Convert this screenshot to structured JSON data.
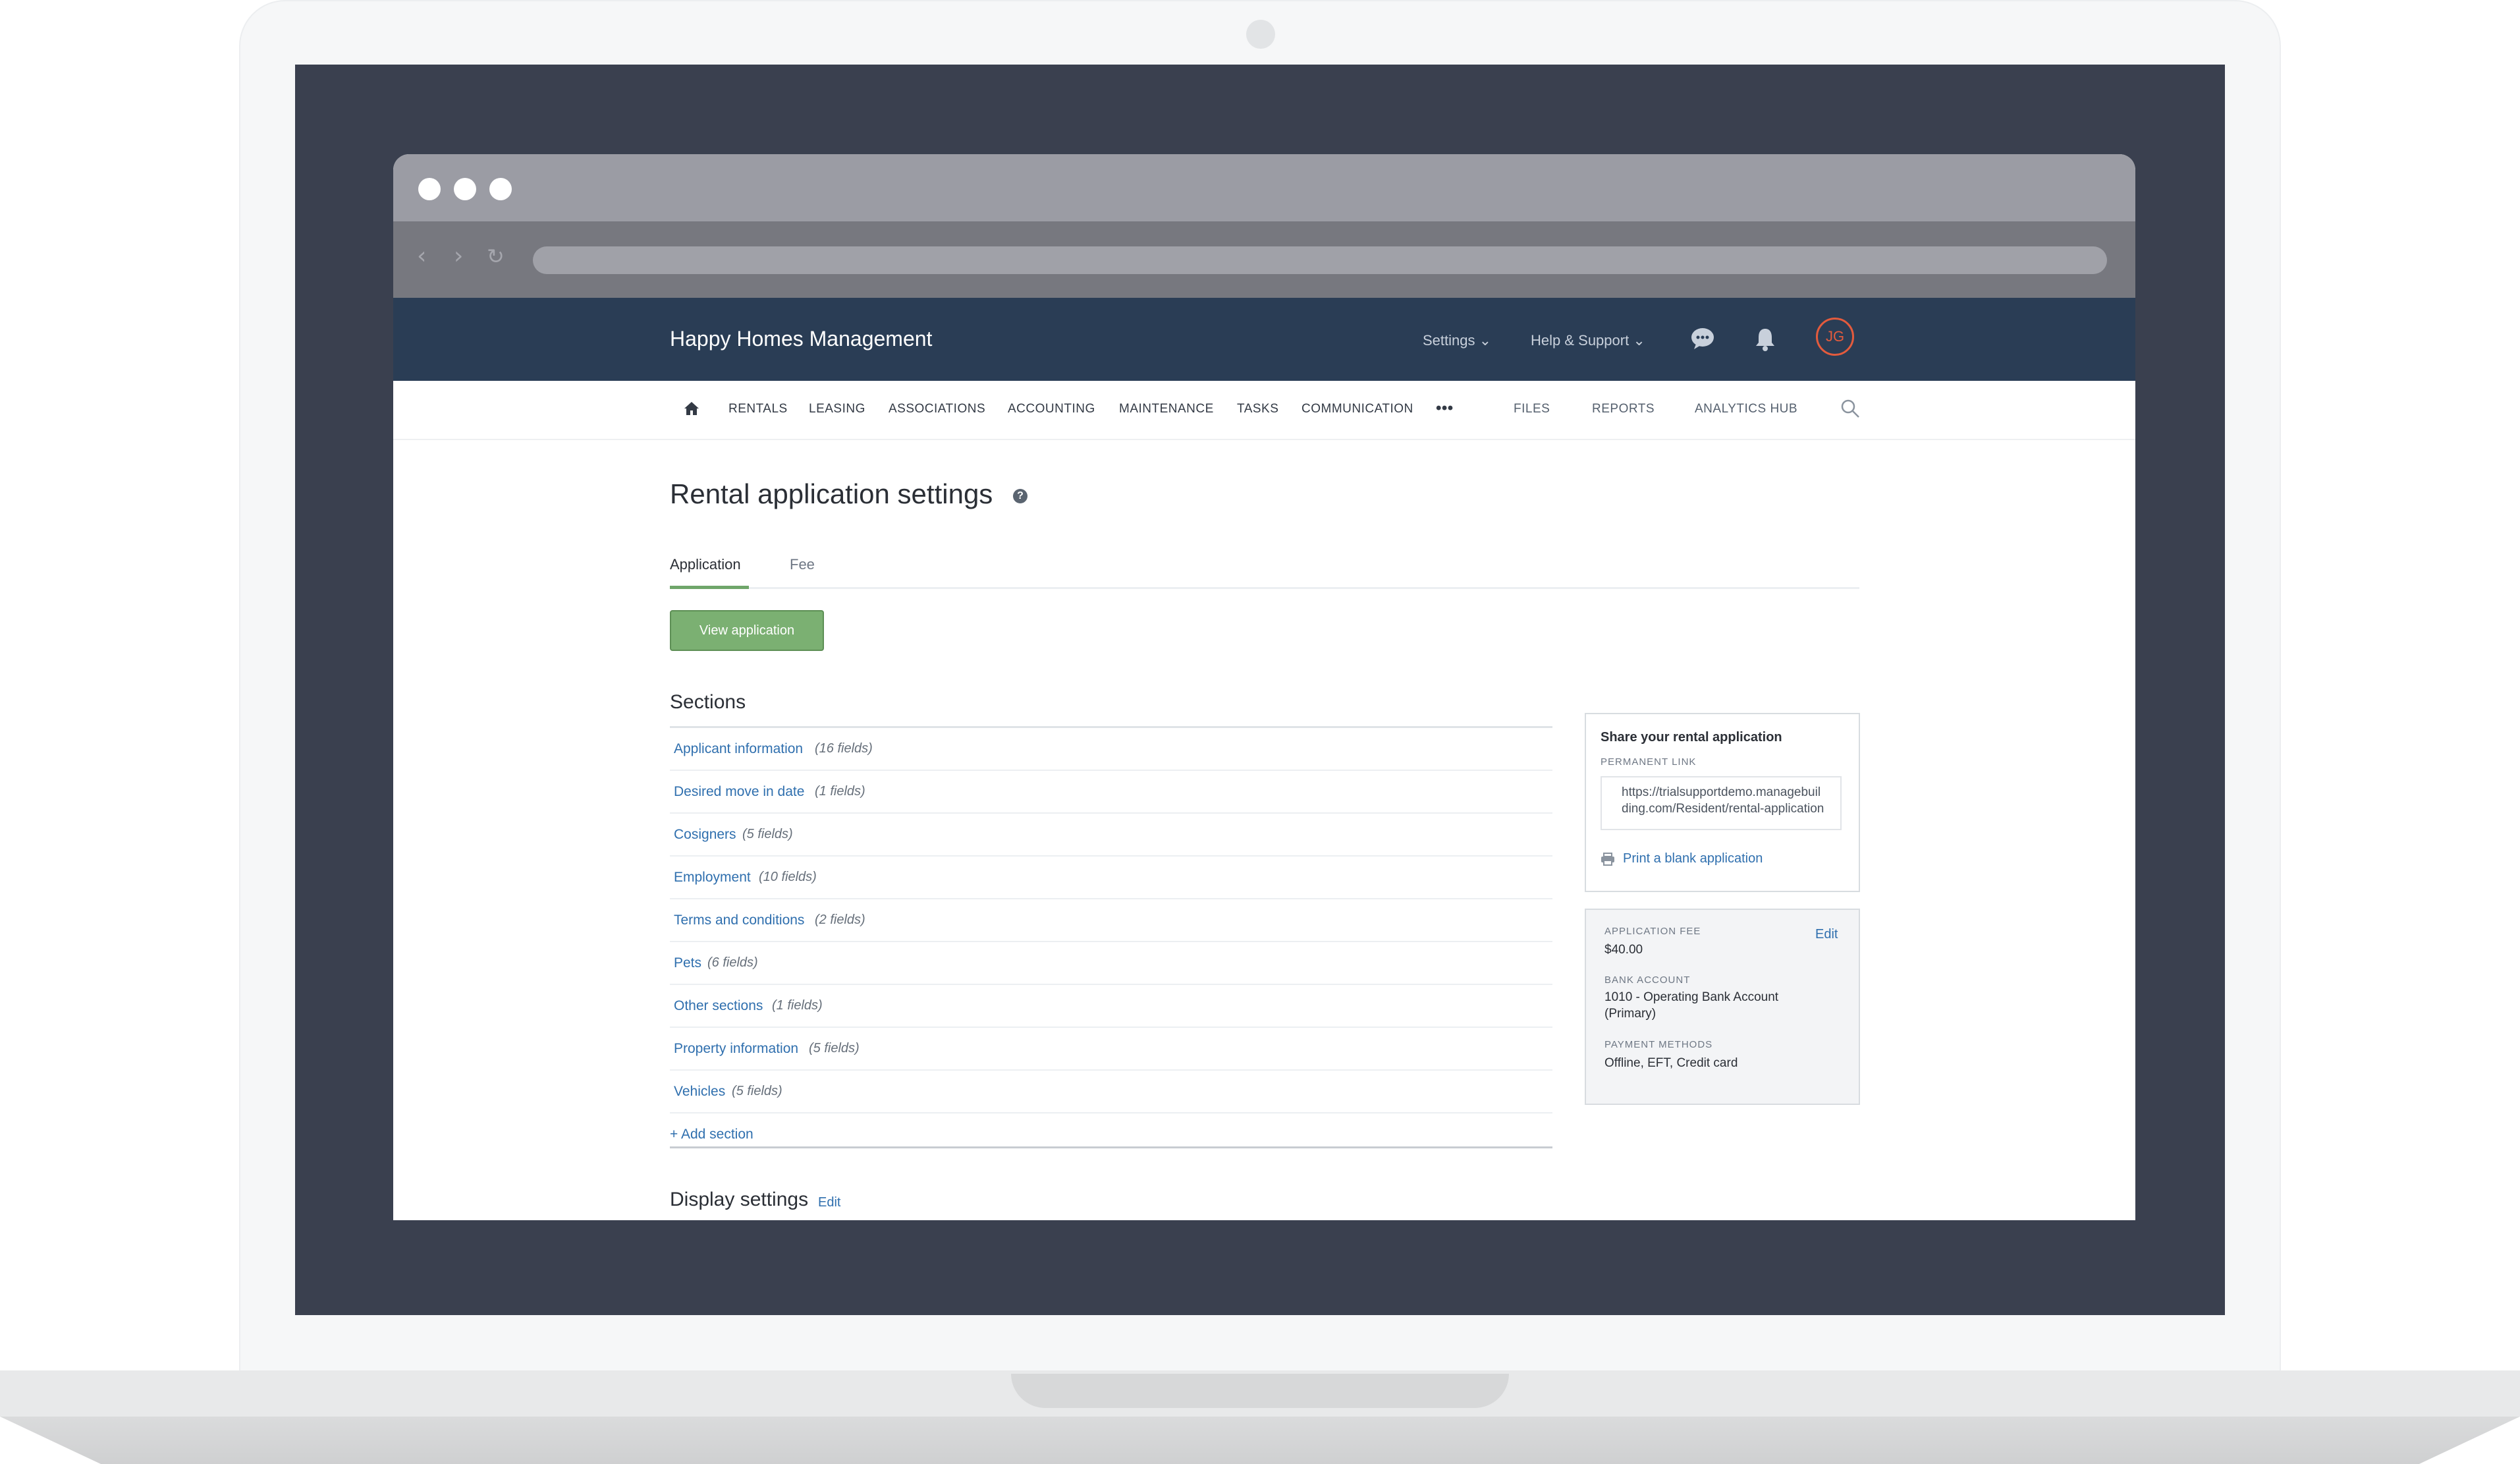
{
  "app": {
    "brand": "Happy Homes Management",
    "top_menu": {
      "settings": "Settings",
      "help": "Help & Support"
    },
    "avatar_initials": "JG",
    "accent_color": "#2a3d55",
    "alert_color": "#e35b3d"
  },
  "nav": {
    "items": [
      "RENTALS",
      "LEASING",
      "ASSOCIATIONS",
      "ACCOUNTING",
      "MAINTENANCE",
      "TASKS",
      "COMMUNICATION"
    ],
    "more": "•••",
    "right_items": [
      "FILES",
      "REPORTS",
      "ANALYTICS HUB"
    ]
  },
  "page": {
    "title": "Rental application settings",
    "help": "?",
    "tabs": [
      "Application",
      "Fee"
    ],
    "view_button": "View application",
    "sections_heading": "Sections",
    "sections": [
      {
        "name": "Applicant information",
        "count": "(16 fields)"
      },
      {
        "name": "Desired move in date",
        "count": "(1 fields)"
      },
      {
        "name": "Cosigners",
        "count": "(5 fields)"
      },
      {
        "name": "Employment",
        "count": "(10 fields)"
      },
      {
        "name": "Terms and conditions",
        "count": "(2 fields)"
      },
      {
        "name": "Pets",
        "count": "(6 fields)"
      },
      {
        "name": "Other sections",
        "count": "(1 fields)"
      },
      {
        "name": "Property information",
        "count": "(5 fields)"
      },
      {
        "name": "Vehicles",
        "count": "(5 fields)"
      }
    ],
    "add_section": "Add section",
    "display_settings": "Display settings",
    "display_edit": "Edit"
  },
  "share": {
    "title": "Share your rental application",
    "permanent_link_label": "PERMANENT LINK",
    "permanent_link": "https://trialsupportdemo.managebuilding.com/Resident/rental-application",
    "print_link": "Print a blank application"
  },
  "fee_box": {
    "application_fee_label": "APPLICATION FEE",
    "application_fee": "$40.00",
    "edit": "Edit",
    "bank_account_label": "BANK ACCOUNT",
    "bank_account": "1010 - Operating Bank Account (Primary)",
    "payment_methods_label": "PAYMENT METHODS",
    "payment_methods": "Offline, EFT, Credit card"
  }
}
